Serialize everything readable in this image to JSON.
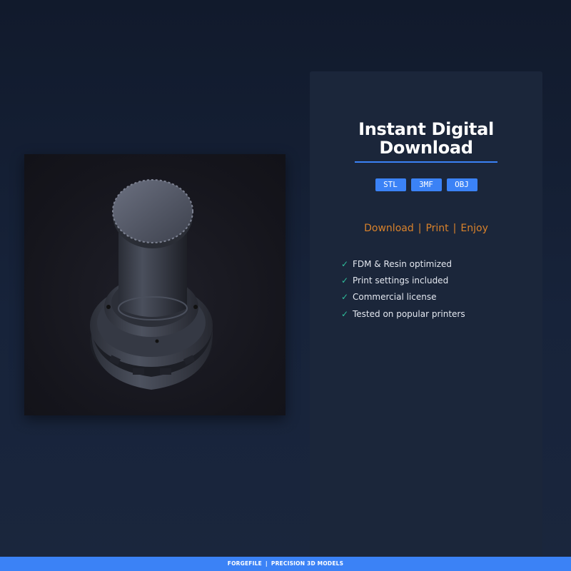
{
  "product": {
    "image_alt_icon": "3d-model-render"
  },
  "panel": {
    "title": "Instant Digital Download",
    "formats": [
      "STL",
      "3MF",
      "OBJ"
    ],
    "tagline": [
      "Download",
      "Print",
      "Enjoy"
    ],
    "tagline_separator": "|",
    "features": [
      "FDM & Resin optimized",
      "Print settings included",
      "Commercial license",
      "Tested on popular printers"
    ],
    "check_icon": "✓"
  },
  "footer": {
    "brand": "FORGEFILE",
    "separator": "|",
    "slogan": "PRECISION 3D MODELS"
  },
  "colors": {
    "accent": "#3b82f6",
    "tagline": "#d9822b",
    "check": "#2fbf9b",
    "panel_bg": "#1b263a"
  }
}
